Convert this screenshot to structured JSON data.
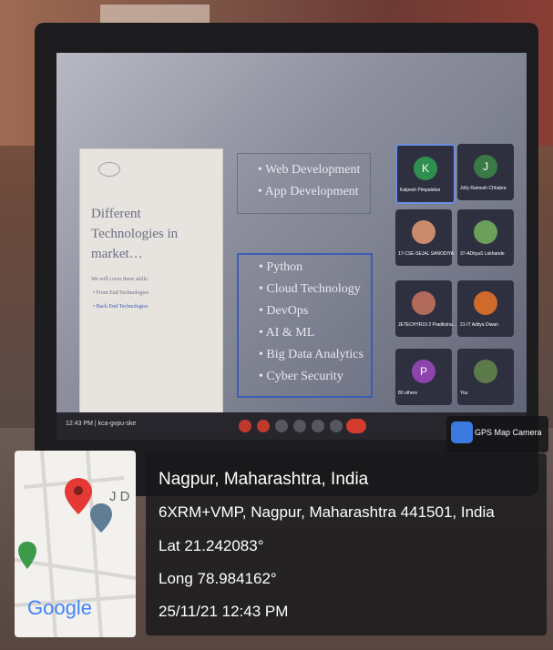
{
  "slide": {
    "title": "Different Technologies in market…",
    "subtitle": "We will cover these skills:",
    "bullets": [
      "Front End Technologies",
      "Back End Technologies"
    ]
  },
  "box1": [
    "Web Development",
    "App Development"
  ],
  "box2": [
    "Python",
    "Cloud Technology",
    "DevOps",
    "AI & ML",
    "Big Data Analytics",
    "Cyber Security"
  ],
  "participants": [
    {
      "initial": "K",
      "name": "Kalpesh Pimpalekar",
      "color": "#2f8f4e"
    },
    {
      "initial": "J",
      "name": "Jolly Ramesh Chhabra",
      "color": "#3a7a45"
    },
    {
      "initial": "",
      "name": "17-CSE-SEJAL SANODIYA",
      "color": "#c98a6d"
    },
    {
      "initial": "",
      "name": "37-ADityaS Lokhande",
      "color": "#6aa05a"
    },
    {
      "initial": "",
      "name": "JETECHYR19 2 Pradiksha…",
      "color": "#b26b5a"
    },
    {
      "initial": "",
      "name": "21-IT Aditya Diwan",
      "color": "#d06a2a"
    },
    {
      "initial": "P",
      "name": "80 others",
      "color": "#8e44ad"
    },
    {
      "initial": "",
      "name": "You",
      "color": "#5d7a4a"
    }
  ],
  "meeting_bar": {
    "time_code": "12:43 PM | kca-gvpu-ske"
  },
  "gps_badge": {
    "label": "GPS Map Camera"
  },
  "map": {
    "brand": "Google",
    "initials": "J D"
  },
  "location": {
    "city": "Nagpur, Maharashtra, India",
    "address": "6XRM+VMP, Nagpur, Maharashtra 441501, India",
    "lat": "Lat 21.242083°",
    "long": "Long 78.984162°",
    "datetime": "25/11/21 12:43 PM"
  }
}
